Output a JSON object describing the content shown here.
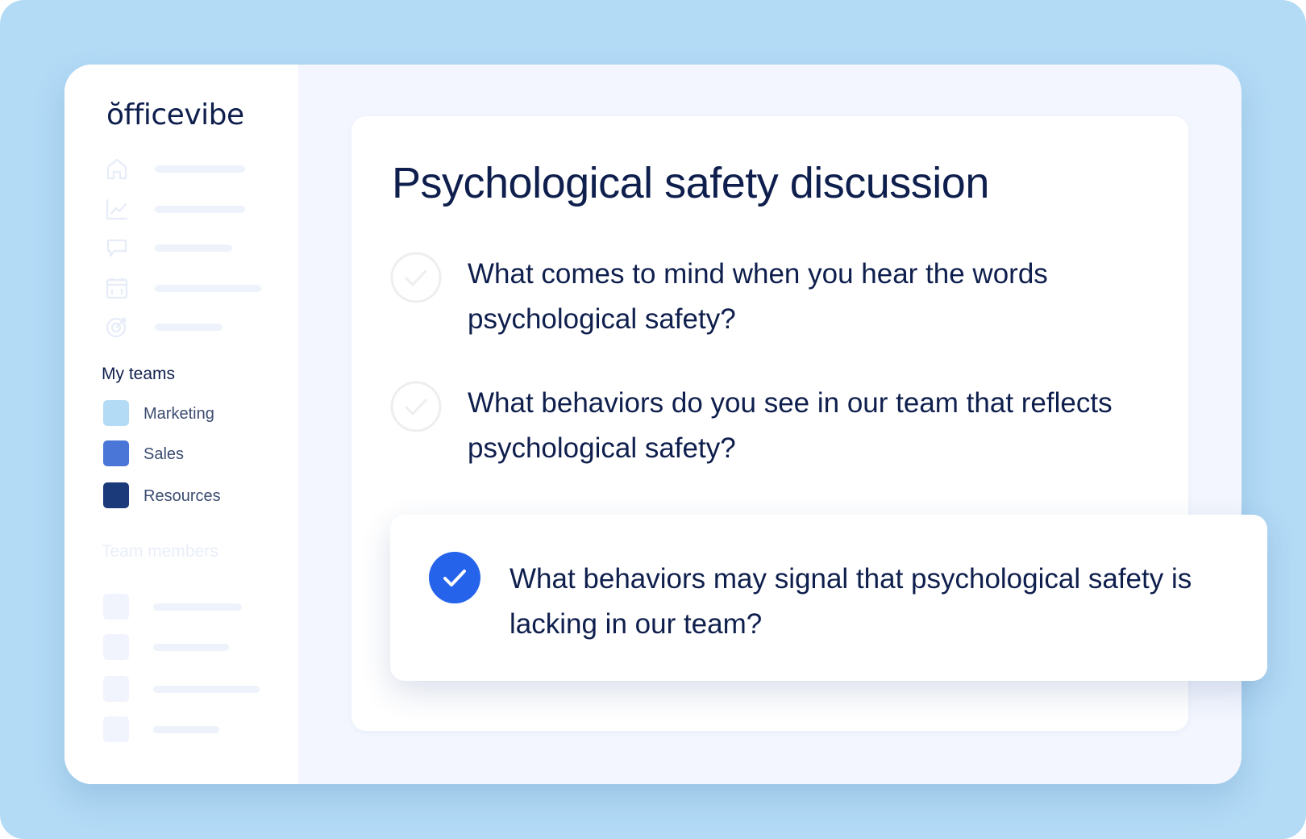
{
  "app": {
    "logo": "ŏfficevibe"
  },
  "sidebar": {
    "nav_icons": [
      "home-icon",
      "chart-icon",
      "chat-icon",
      "calendar-icon",
      "goal-icon"
    ],
    "my_teams_title": "My teams",
    "teams": [
      {
        "label": "Marketing",
        "color": "#b3dbf6"
      },
      {
        "label": "Sales",
        "color": "#4a76d8"
      },
      {
        "label": "Resources",
        "color": "#1b3a7a"
      }
    ],
    "team_members_title": "Team members"
  },
  "main": {
    "title": "Psychological safety discussion",
    "questions": [
      {
        "text": "What comes to mind when you hear the words psychological safety?",
        "checked": false
      },
      {
        "text": "What behaviors do you see in our team that reflects psychological safety?",
        "checked": false
      },
      {
        "text": "What behaviors may signal that psychological safety is lacking in our team?",
        "checked": true
      }
    ]
  },
  "colors": {
    "background": "#b3dbf6",
    "accent": "#2563eb",
    "text": "#0f1f4d"
  }
}
